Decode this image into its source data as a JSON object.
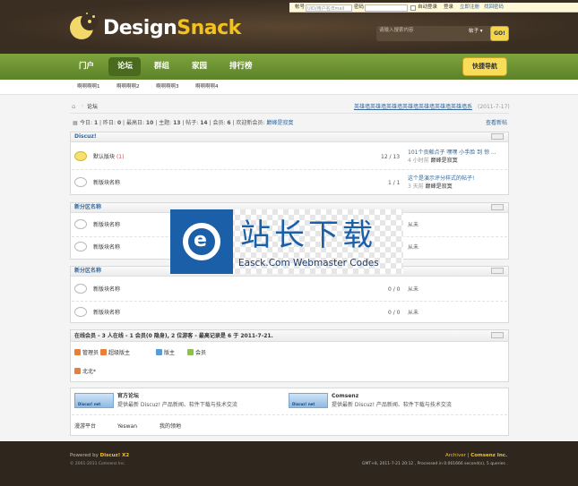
{
  "login": {
    "account_label": "帐号",
    "account_placeholder": "UID/用户名/Email",
    "password_label": "密码",
    "auto_login": "自动登录",
    "login_btn": "登录",
    "register_btn": "立即注册",
    "retrieve_btn": "找回密码"
  },
  "logo": {
    "part1": "Design",
    "part2": "Snack"
  },
  "search": {
    "placeholder": "请输入搜索内容",
    "select": "帖子",
    "button": "GO!"
  },
  "nav": {
    "items": [
      "门户",
      "论坛",
      "群组",
      "家园",
      "排行榜"
    ],
    "quick_nav": "快捷导航"
  },
  "subnav": [
    "啊啊啊啊1",
    "啊啊啊啊2",
    "啊啊啊啊3",
    "啊啊啊啊4"
  ],
  "breadcrumb": {
    "current": "论坛",
    "marquee": "英雄墙英雄墙英雄墙英雄墙英雄墙英雄墙英雄墙系",
    "date": "(2011-7-17)"
  },
  "stats": {
    "today_label": "今日:",
    "today": "1",
    "yesterday_label": "昨日:",
    "yesterday": "0",
    "max_label": "最高日:",
    "max": "10",
    "threads_label": "主题:",
    "threads": "13",
    "posts_label": "帖子:",
    "posts": "14",
    "members_label": "会员:",
    "members": "6",
    "welcome": "欢迎新会员:",
    "newuser": "巅峰是寂寞",
    "view_new": "查看新帖"
  },
  "cat1": {
    "title": "Discuz!",
    "forums": [
      {
        "name": "默认版块",
        "new": "(1)",
        "count": "12 / 13",
        "last_title": "101个贡献点子 嘿嘿 小手脸 到 惊 ...",
        "last_info": "4 小时前",
        "last_user": "巅峰是寂寞"
      },
      {
        "name": "新版块名称",
        "count": "1 / 1",
        "last_title": "这个是演示评分样式的帖子!",
        "last_info": "3 天前",
        "last_user": "巅峰是寂寞"
      }
    ]
  },
  "cat2": {
    "title": "新分区名称",
    "forums": [
      {
        "name": "新版块名称",
        "last": "从未"
      },
      {
        "name": "新版块名称",
        "last": "从未"
      }
    ]
  },
  "cat3": {
    "title": "新分区名称",
    "forums": [
      {
        "name": "新版块名称",
        "count": "0 / 0",
        "last": "从未"
      },
      {
        "name": "新版块名称",
        "count": "0 / 0",
        "last": "从未"
      }
    ]
  },
  "online": {
    "title": "在线会员 - 3 人在线 - 1 会员(0 隐身), 2 位游客 - 最高记录是 6 于 2011-7-21.",
    "legend": [
      "管理员",
      "超级版主",
      "版主",
      "会员"
    ],
    "user": "北北*"
  },
  "links": {
    "items": [
      {
        "badge": "Discuz! net",
        "name": "官方论坛",
        "desc": "提供最新 Discuz! 产品新闻、软件下载与技术交流"
      },
      {
        "badge": "Discuz! net",
        "name": "Comsenz",
        "desc": "提供最新 Discuz! 产品新闻、软件下载与技术交流"
      }
    ],
    "text_links": [
      "漫游平台",
      "Yeswan",
      "我的领地"
    ]
  },
  "watermark": {
    "title": "站长下载",
    "sub": "Easck.Com Webmaster Codes"
  },
  "footer": {
    "powered": "Powered by",
    "product": "Discuz! X2",
    "copyright": "© 2001-2011 Comsenz Inc.",
    "archiver": "Archiver",
    "company": "Comsenz Inc.",
    "time": "GMT+8, 2011-7-21 20:12 , Processed in 0.061666 second(s), 5 queries ."
  },
  "colors": {
    "header": "#3a2e22",
    "nav": "#6a9231",
    "accent": "#f4d64e",
    "link": "#336699",
    "footer": "#2f261d"
  }
}
